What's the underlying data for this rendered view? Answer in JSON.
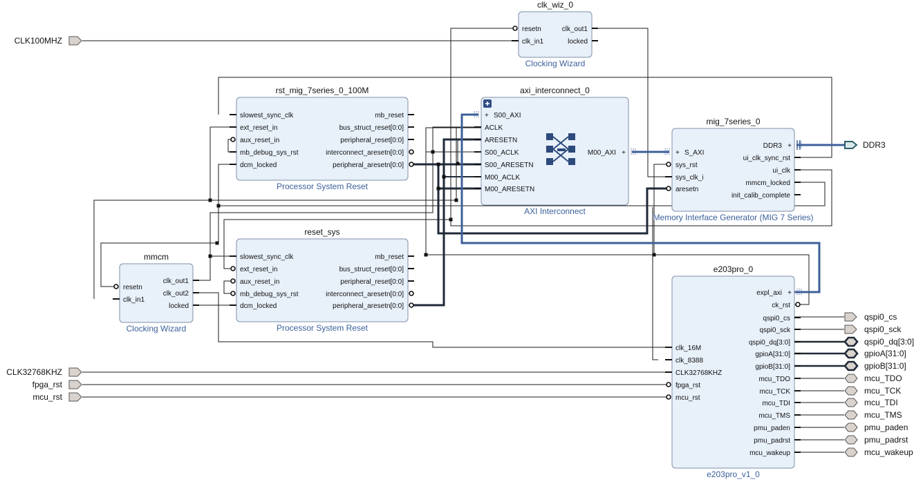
{
  "colors": {
    "block_fill": "#e8f0fa",
    "block_stroke": "#7f8fa8",
    "wire": "#1a1a1a",
    "bus": "#3d5f98",
    "port_fill": "#d9d2cd",
    "port_stroke": "#555555",
    "subtitle": "#3a5f9a"
  },
  "external_inputs": [
    {
      "id": "clk100",
      "label": "CLK100MHZ"
    },
    {
      "id": "clk32",
      "label": "CLK32768KHZ"
    },
    {
      "id": "fpgarst",
      "label": "fpga_rst"
    },
    {
      "id": "mcurst",
      "label": "mcu_rst"
    }
  ],
  "external_outputs": [
    {
      "id": "ddr3",
      "label": "DDR3"
    },
    {
      "id": "qcs",
      "label": "qspi0_cs"
    },
    {
      "id": "qsck",
      "label": "qspi0_sck"
    },
    {
      "id": "qdq",
      "label": "qspi0_dq[3:0]"
    },
    {
      "id": "gpa",
      "label": "gpioA[31:0]"
    },
    {
      "id": "gpb",
      "label": "gpioB[31:0]"
    },
    {
      "id": "tdo",
      "label": "mcu_TDO"
    },
    {
      "id": "tck",
      "label": "mcu_TCK"
    },
    {
      "id": "tdi",
      "label": "mcu_TDI"
    },
    {
      "id": "tms",
      "label": "mcu_TMS"
    },
    {
      "id": "paden",
      "label": "pmu_paden"
    },
    {
      "id": "padrst",
      "label": "pmu_padrst"
    },
    {
      "id": "wakeup",
      "label": "mcu_wakeup"
    }
  ],
  "blocks": [
    {
      "id": "clkwiz",
      "title": "clk_wiz_0",
      "subtitle": "Clocking Wizard",
      "inputs": [
        "resetn",
        "clk_in1"
      ],
      "outputs": [
        "clk_out1",
        "locked"
      ]
    },
    {
      "id": "rst1",
      "title": "rst_mig_7series_0_100M",
      "subtitle": "Processor System Reset",
      "inputs": [
        "slowest_sync_clk",
        "ext_reset_in",
        "aux_reset_in",
        "mb_debug_sys_rst",
        "dcm_locked"
      ],
      "outputs": [
        "mb_reset",
        "bus_struct_reset[0:0]",
        "peripheral_reset[0:0]",
        "interconnect_aresetn[0:0]",
        "peripheral_aresetn[0:0]"
      ]
    },
    {
      "id": "axi",
      "title": "axi_interconnect_0",
      "subtitle": "AXI Interconnect",
      "inputs": [
        "S00_AXI",
        "ACLK",
        "ARESETN",
        "S00_ACLK",
        "S00_ARESETN",
        "M00_ACLK",
        "M00_ARESETN"
      ],
      "outputs": [
        "M00_AXI"
      ]
    },
    {
      "id": "mig",
      "title": "mig_7series_0",
      "subtitle": "Memory Interface Generator (MIG 7 Series)",
      "inputs": [
        "S_AXI",
        "sys_rst",
        "sys_clk_i",
        "aresetn"
      ],
      "outputs": [
        "DDR3",
        "ui_clk_sync_rst",
        "ui_clk",
        "mmcm_locked",
        "init_calib_complete"
      ]
    },
    {
      "id": "mmcm",
      "title": "mmcm",
      "subtitle": "Clocking Wizard",
      "inputs": [
        "resetn",
        "clk_in1"
      ],
      "outputs": [
        "clk_out1",
        "clk_out2",
        "locked"
      ]
    },
    {
      "id": "rst2",
      "title": "reset_sys",
      "subtitle": "Processor System Reset",
      "inputs": [
        "slowest_sync_clk",
        "ext_reset_in",
        "aux_reset_in",
        "mb_debug_sys_rst",
        "dcm_locked"
      ],
      "outputs": [
        "mb_reset",
        "bus_struct_reset[0:0]",
        "peripheral_reset[0:0]",
        "interconnect_aresetn[0:0]",
        "peripheral_aresetn[0:0]"
      ]
    },
    {
      "id": "e203",
      "title": "e203pro_0",
      "subtitle": "e203pro_v1_0",
      "inputs": [
        "clk_16M",
        "clk_8388",
        "CLK32768KHZ",
        "fpga_rst",
        "mcu_rst"
      ],
      "outputs": [
        "expl_axi",
        "ck_rst",
        "qspi0_cs",
        "qspi0_sck",
        "qspi0_dq[3:0]",
        "gpioA[31:0]",
        "gpioB[31:0]",
        "mcu_TDO",
        "mcu_TCK",
        "mcu_TDI",
        "mcu_TMS",
        "pmu_paden",
        "pmu_padrst",
        "mcu_wakeup"
      ]
    }
  ]
}
